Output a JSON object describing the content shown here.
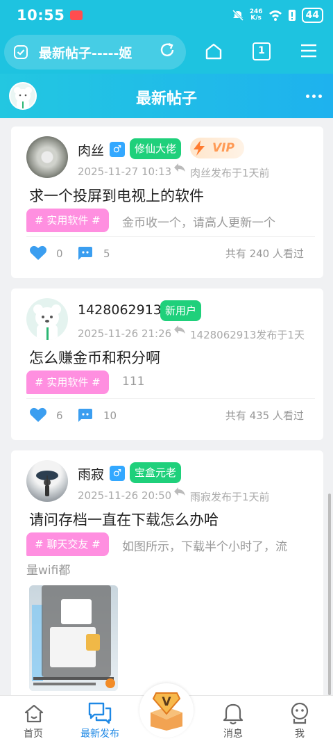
{
  "status_bar": {
    "time": "10:55",
    "net_speed_top": "246",
    "net_speed_bottom": "K/s",
    "battery": "44"
  },
  "browser": {
    "url_text": "最新帖子-----姬",
    "tab_count": "1"
  },
  "header": {
    "title": "最新帖子"
  },
  "posts": [
    {
      "username": "肉丝",
      "gender": "♂",
      "badge": "修仙大佬",
      "vip_label": "VIP",
      "datetime": "2025-11-27 10:13",
      "author_note": "肉丝发布于1天前",
      "title": "求一个投屏到电视上的软件",
      "tag": "# 实用软件 #",
      "excerpt": "金币收一个，请高人更新一个",
      "likes": "0",
      "comments": "5",
      "views": "共有 240 人看过"
    },
    {
      "username": "1428062913",
      "badge": "新用户",
      "datetime": "2025-11-26 21:26",
      "author_note": "1428062913发布于1天",
      "title": "怎么赚金币和积分啊",
      "tag": "# 实用软件 #",
      "excerpt": "111",
      "likes": "6",
      "comments": "10",
      "views": "共有 435 人看过"
    },
    {
      "username": "雨寂",
      "gender": "♂",
      "badge": "宝盒元老",
      "datetime": "2025-11-26 20:50",
      "author_note": "雨寂发布于1天前",
      "title": "请问存档一直在下载怎么办哈",
      "tag": "# 聊天交友 #",
      "excerpt_line1": "如图所示，下载半个小时了，流",
      "excerpt_line2": "量wifi都"
    }
  ],
  "nav": {
    "home": "首页",
    "latest": "最新发布",
    "messages": "消息",
    "me": "我"
  },
  "colors": {
    "accent": "#1ec3e0",
    "badge_green": "#1fd07b",
    "tag_pink": "#ff8fe0",
    "like_blue": "#3b9ef0",
    "nav_active": "#1e88e5"
  }
}
